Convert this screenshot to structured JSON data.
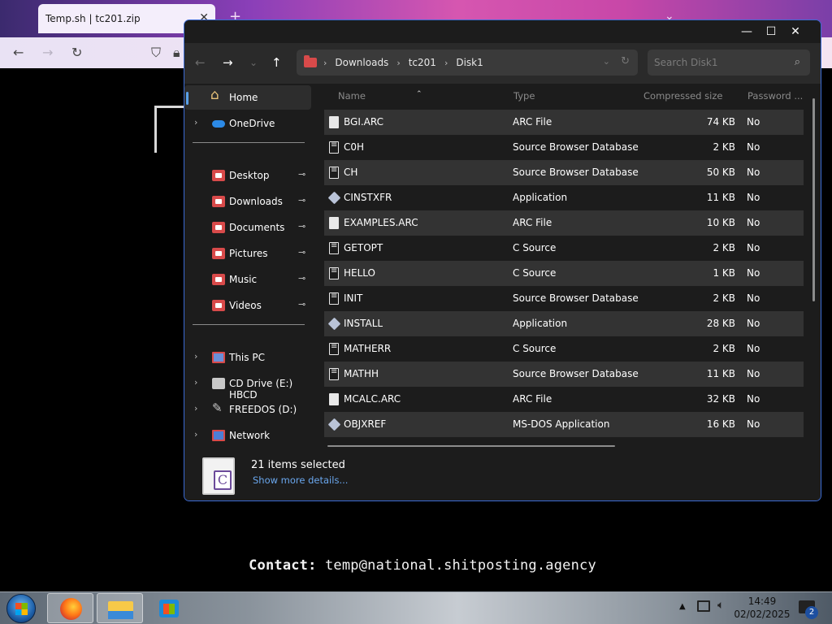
{
  "browser": {
    "tab_title": "Temp.sh | tc201.zip",
    "tab_close": "✕",
    "new_tab": "+",
    "tab_list": "⌄",
    "contact_label": "Contact:",
    "contact_email": "temp@national.shitposting.agency"
  },
  "explorer": {
    "controls": {
      "minimize": "—",
      "maximize": "☐",
      "close": "✕"
    },
    "nav": {
      "back": "←",
      "forward": "→",
      "recent": "⌄",
      "up": "↑"
    },
    "breadcrumb": [
      "Downloads",
      "tc201",
      "Disk1"
    ],
    "search_placeholder": "Search Disk1",
    "sidebar": {
      "home": "Home",
      "onedrive": "OneDrive",
      "quick": [
        "Desktop",
        "Downloads",
        "Documents",
        "Pictures",
        "Music",
        "Videos"
      ],
      "drives": [
        "This PC",
        "CD Drive (E:) HBCD",
        "FREEDOS (D:)",
        "Network"
      ]
    },
    "columns": {
      "name": "Name",
      "type": "Type",
      "size": "Compressed size",
      "password": "Password ..."
    },
    "files": [
      {
        "name": "BGI.ARC",
        "type": "ARC File",
        "size": "74 KB",
        "password": "No",
        "icon": "file-icon"
      },
      {
        "name": "C0H",
        "type": "Source Browser Database",
        "size": "2 KB",
        "password": "No",
        "icon": "source-file-icon"
      },
      {
        "name": "CH",
        "type": "Source Browser Database",
        "size": "50 KB",
        "password": "No",
        "icon": "source-file-icon"
      },
      {
        "name": "CINSTXFR",
        "type": "Application",
        "size": "11 KB",
        "password": "No",
        "icon": "application-icon"
      },
      {
        "name": "EXAMPLES.ARC",
        "type": "ARC File",
        "size": "10 KB",
        "password": "No",
        "icon": "file-icon"
      },
      {
        "name": "GETOPT",
        "type": "C Source",
        "size": "2 KB",
        "password": "No",
        "icon": "source-file-icon"
      },
      {
        "name": "HELLO",
        "type": "C Source",
        "size": "1 KB",
        "password": "No",
        "icon": "source-file-icon"
      },
      {
        "name": "INIT",
        "type": "Source Browser Database",
        "size": "2 KB",
        "password": "No",
        "icon": "source-file-icon"
      },
      {
        "name": "INSTALL",
        "type": "Application",
        "size": "28 KB",
        "password": "No",
        "icon": "application-icon"
      },
      {
        "name": "MATHERR",
        "type": "C Source",
        "size": "2 KB",
        "password": "No",
        "icon": "source-file-icon"
      },
      {
        "name": "MATHH",
        "type": "Source Browser Database",
        "size": "11 KB",
        "password": "No",
        "icon": "source-file-icon"
      },
      {
        "name": "MCALC.ARC",
        "type": "ARC File",
        "size": "32 KB",
        "password": "No",
        "icon": "file-icon"
      },
      {
        "name": "OBJXREF",
        "type": "MS-DOS Application",
        "size": "16 KB",
        "password": "No",
        "icon": "application-icon"
      }
    ],
    "status": {
      "selected": "21 items selected",
      "more_details": "Show more details..."
    }
  },
  "taskbar": {
    "time": "14:49",
    "date": "02/02/2025",
    "notification_count": "2"
  },
  "colors": {
    "accent": "#3b6bd4",
    "link": "#6aa7ee",
    "folder": "#d84a4a"
  }
}
